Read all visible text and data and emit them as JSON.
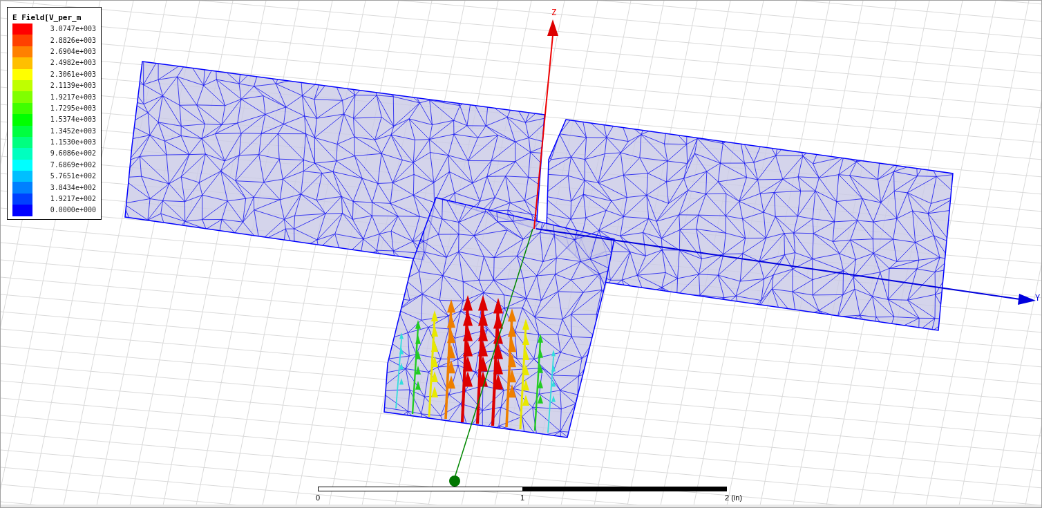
{
  "legend": {
    "title": "E Field[V_per_m",
    "levels": [
      {
        "value": "3.0747e+003",
        "color": "#ff0000"
      },
      {
        "value": "2.8826e+003",
        "color": "#ff4000"
      },
      {
        "value": "2.6904e+003",
        "color": "#ff8000"
      },
      {
        "value": "2.4982e+003",
        "color": "#ffbf00"
      },
      {
        "value": "2.3061e+003",
        "color": "#ffff00"
      },
      {
        "value": "2.1139e+003",
        "color": "#bfff00"
      },
      {
        "value": "1.9217e+003",
        "color": "#80ff00"
      },
      {
        "value": "1.7295e+003",
        "color": "#40ff00"
      },
      {
        "value": "1.5374e+003",
        "color": "#00ff00"
      },
      {
        "value": "1.3452e+003",
        "color": "#00ff40"
      },
      {
        "value": "1.1530e+003",
        "color": "#00ff80"
      },
      {
        "value": "9.6086e+002",
        "color": "#00ffbf"
      },
      {
        "value": "7.6869e+002",
        "color": "#00ffff"
      },
      {
        "value": "5.7651e+002",
        "color": "#00bfff"
      },
      {
        "value": "3.8434e+002",
        "color": "#0080ff"
      },
      {
        "value": "1.9217e+002",
        "color": "#0040ff"
      },
      {
        "value": "0.0000e+000",
        "color": "#0000ff"
      }
    ]
  },
  "axes": {
    "z_label": "Z",
    "y_label": "Y"
  },
  "scale": {
    "labels": [
      "0",
      "1",
      "2 (in)"
    ]
  }
}
